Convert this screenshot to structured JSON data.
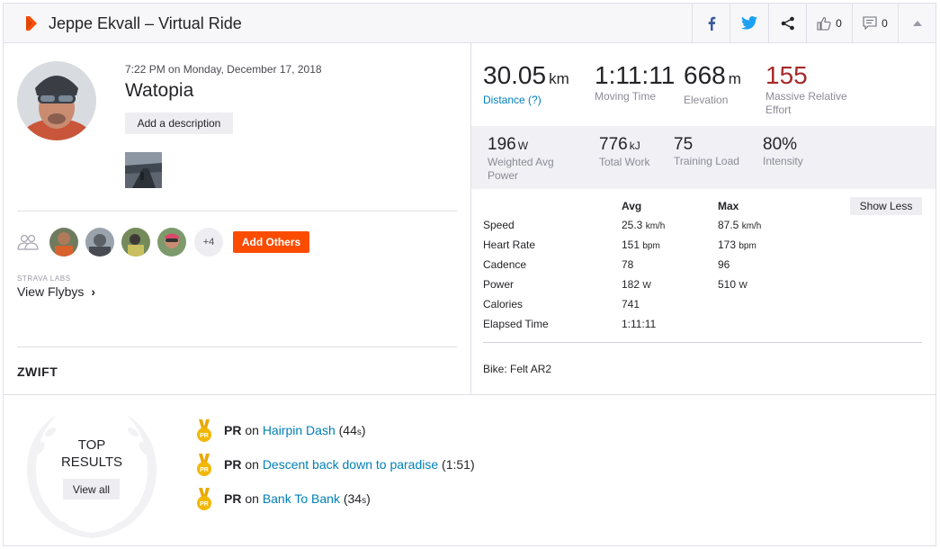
{
  "header": {
    "title": "Jeppe Ekvall – Virtual Ride",
    "kudos_count": "0",
    "comments_count": "0"
  },
  "activity": {
    "datetime": "7:22 PM on Monday, December 17, 2018",
    "location": "Watopia",
    "add_description_label": "Add a description"
  },
  "athletes": {
    "more_label": "+4",
    "add_others_label": "Add Others"
  },
  "labs": {
    "label": "STRAVA LABS",
    "flybys_label": "View Flybys",
    "flybys_chevron": "›"
  },
  "device": {
    "name": "ZWIFT"
  },
  "primary_stats": [
    {
      "value": "30.05",
      "unit": "km",
      "label": "Distance (?)"
    },
    {
      "value": "1:11:11",
      "unit": "",
      "label": "Moving Time"
    },
    {
      "value": "668",
      "unit": "m",
      "label": "Elevation"
    },
    {
      "value": "155",
      "unit": "",
      "label": "Massive Relative",
      "label2": "Effort"
    }
  ],
  "secondary_stats": [
    {
      "value": "196",
      "unit": "W",
      "label": "Weighted Avg",
      "label2": "Power"
    },
    {
      "value": "776",
      "unit": "kJ",
      "label": "Total Work"
    },
    {
      "value": "75",
      "unit": "",
      "label": "Training Load"
    },
    {
      "value": "80%",
      "unit": "",
      "label": "Intensity"
    }
  ],
  "details_table": {
    "headers": {
      "avg": "Avg",
      "max": "Max"
    },
    "show_less_label": "Show Less",
    "rows": [
      {
        "label": "Speed",
        "avg": "25.3",
        "avg_unit": "km/h",
        "max": "87.5",
        "max_unit": "km/h"
      },
      {
        "label": "Heart Rate",
        "avg": "151",
        "avg_unit": "bpm",
        "max": "173",
        "max_unit": "bpm"
      },
      {
        "label": "Cadence",
        "avg": "78",
        "avg_unit": "",
        "max": "96",
        "max_unit": ""
      },
      {
        "label": "Power",
        "avg": "182",
        "avg_unit": "W",
        "max": "510",
        "max_unit": "W"
      },
      {
        "label": "Calories",
        "avg": "741",
        "avg_unit": "",
        "max": "",
        "max_unit": ""
      },
      {
        "label": "Elapsed Time",
        "avg": "1:11:11",
        "avg_unit": "",
        "max": "",
        "max_unit": ""
      }
    ],
    "bike": "Bike: Felt AR2"
  },
  "top_results": {
    "title_line1": "TOP",
    "title_line2": "RESULTS",
    "view_all_label": "View all",
    "items": [
      {
        "badge": "PR",
        "prefix": "PR",
        "on": "on",
        "segment": "Hairpin Dash",
        "time": "(44",
        "time_unit": "s",
        "time_close": ")"
      },
      {
        "badge": "PR",
        "prefix": "PR",
        "on": "on",
        "segment": "Descent back down to paradise",
        "time": "(1:51)",
        "time_unit": "",
        "time_close": ""
      },
      {
        "badge": "PR",
        "prefix": "PR",
        "on": "on",
        "segment": "Bank To Bank",
        "time": "(34",
        "time_unit": "s",
        "time_close": ")"
      }
    ]
  },
  "colors": {
    "accent": "#fc4c02",
    "link": "#007fb6",
    "relative_effort": "#a52a2a",
    "medal": "#f2b705"
  },
  "icons": [
    "strava-chevron-icon",
    "facebook-icon",
    "twitter-icon",
    "share-icon",
    "kudos-icon",
    "comment-icon",
    "collapse-icon",
    "group-icon",
    "medal-icon",
    "wreath-icon"
  ]
}
